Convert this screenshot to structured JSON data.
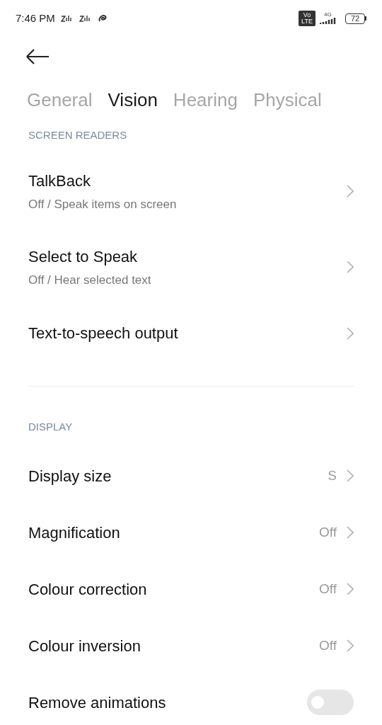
{
  "status_bar": {
    "time": "7:46 PM",
    "volte": [
      "Vo",
      "LTE"
    ],
    "network": "4G",
    "battery": "72"
  },
  "tabs": [
    {
      "label": "General",
      "selected": false
    },
    {
      "label": "Vision",
      "selected": true
    },
    {
      "label": "Hearing",
      "selected": false
    },
    {
      "label": "Physical",
      "selected": false
    }
  ],
  "sections": [
    {
      "header": "SCREEN READERS",
      "items": [
        {
          "kind": "nav",
          "title": "TalkBack",
          "subtitle": "Off / Speak items on screen"
        },
        {
          "kind": "nav",
          "title": "Select to Speak",
          "subtitle": "Off / Hear selected text"
        },
        {
          "kind": "nav",
          "title": "Text-to-speech output"
        }
      ]
    },
    {
      "header": "DISPLAY",
      "items": [
        {
          "kind": "nav",
          "title": "Display size",
          "value": "S"
        },
        {
          "kind": "nav",
          "title": "Magnification",
          "value": "Off"
        },
        {
          "kind": "nav",
          "title": "Colour correction",
          "value": "Off"
        },
        {
          "kind": "nav",
          "title": "Colour inversion",
          "value": "Off"
        },
        {
          "kind": "toggle",
          "title": "Remove animations",
          "on": false
        }
      ]
    }
  ]
}
